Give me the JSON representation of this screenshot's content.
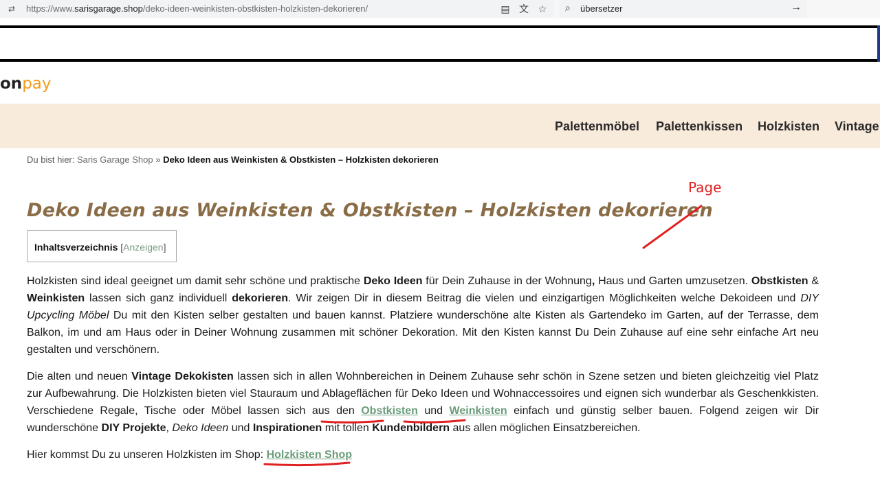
{
  "browser": {
    "url_prefix": "https://www.",
    "url_host": "sarisgarage.shop",
    "url_path": "/deko-ideen-weinkisten-obstkisten-holzkisten-dekorieren/",
    "search_text": "übersetzer"
  },
  "header": {
    "logo_partial_on": "on",
    "logo_partial_pay": "pay"
  },
  "nav": {
    "items": [
      "Palettenmöbel",
      "Palettenkissen",
      "Holzkisten",
      "Vintage"
    ]
  },
  "breadcrumb": {
    "prefix": "Du bist hier:",
    "home": "Saris Garage Shop",
    "separator": "»",
    "current": "Deko Ideen aus Weinkisten & Obstkisten – Holzkisten dekorieren"
  },
  "page": {
    "title": "Deko Ideen aus Weinkisten & Obstkisten – Holzkisten dekorieren"
  },
  "annotation": {
    "label": "Page",
    "color": "#e02020"
  },
  "toc": {
    "title": "Inhaltsverzeichnis",
    "toggle_open": "[",
    "toggle_label": "Anzeigen",
    "toggle_close": "]"
  },
  "content": {
    "p1": [
      {
        "t": "Holzkisten sind ideal geeignet um damit sehr schöne und praktische "
      },
      {
        "b": "Deko Ideen"
      },
      {
        "t": " für Dein Zuhause in der Wohnung"
      },
      {
        "b": ","
      },
      {
        "t": " Haus und Garten umzusetzen. "
      },
      {
        "b": "Obstkisten"
      },
      {
        "t": " & "
      },
      {
        "b": "Weinkisten"
      },
      {
        "t": " lassen sich ganz individuell "
      },
      {
        "b": "dekorieren"
      },
      {
        "t": ". Wir zeigen Dir in diesem Beitrag die vielen und einzigartigen Möglichkeiten welche Dekoideen und "
      },
      {
        "i": "DIY Upcycling Möbel"
      },
      {
        "t": " Du mit den Kisten selber gestalten und bauen kannst. Platziere wunderschöne alte Kisten als Gartendeko im Garten, auf der Terrasse, dem Balkon, im und am Haus oder in Deiner Wohnung zusammen mit schöner Dekoration. Mit den Kisten kannst Du Dein Zuhause auf eine sehr einfache Art neu gestalten und verschönern."
      }
    ],
    "p2": [
      {
        "t": "Die alten und neuen "
      },
      {
        "b": "Vintage Dekokisten"
      },
      {
        "t": " lassen sich in allen Wohnbereichen in Deinem Zuhause sehr schön in Szene setzen und bieten gleichzeitig viel Platz zur Aufbewahrung. Die Holzkisten bieten viel Stauraum und Ablageflächen für Deko Ideen und Wohnaccessoires und eignen sich wunderbar als Geschenkkisten. Verschiedene Regale, Tische oder Möbel lassen sich aus den "
      },
      {
        "a": "Obstkisten",
        "n": "link-obstkisten"
      },
      {
        "t": " und "
      },
      {
        "a": "Weinkisten",
        "n": "link-weinkisten"
      },
      {
        "t": " einfach und günstig selber bauen. Folgend zeigen wir Dir wunderschöne "
      },
      {
        "b": "DIY Projekte"
      },
      {
        "t": ", "
      },
      {
        "i": "Deko Ideen"
      },
      {
        "t": " und "
      },
      {
        "b": "Inspirationen"
      },
      {
        "t": " mit tollen "
      },
      {
        "b": "Kundenbildern"
      },
      {
        "t": " aus allen möglichen Einsatzbereichen."
      }
    ],
    "p3": [
      {
        "t": "Hier kommst Du zu unseren Holzkisten im Shop: "
      },
      {
        "a": "Holzkisten Shop",
        "n": "link-holzkisten-shop"
      }
    ]
  },
  "colors": {
    "nav_bg": "#f9ebdc",
    "title": "#8a6d47",
    "link": "#6b9c7a",
    "pay_orange": "#f49b1a"
  },
  "icons": [
    "site-info-icon",
    "reader-mode-icon",
    "translate-icon",
    "bookmark-star-icon",
    "search-icon",
    "arrow-right-icon"
  ]
}
